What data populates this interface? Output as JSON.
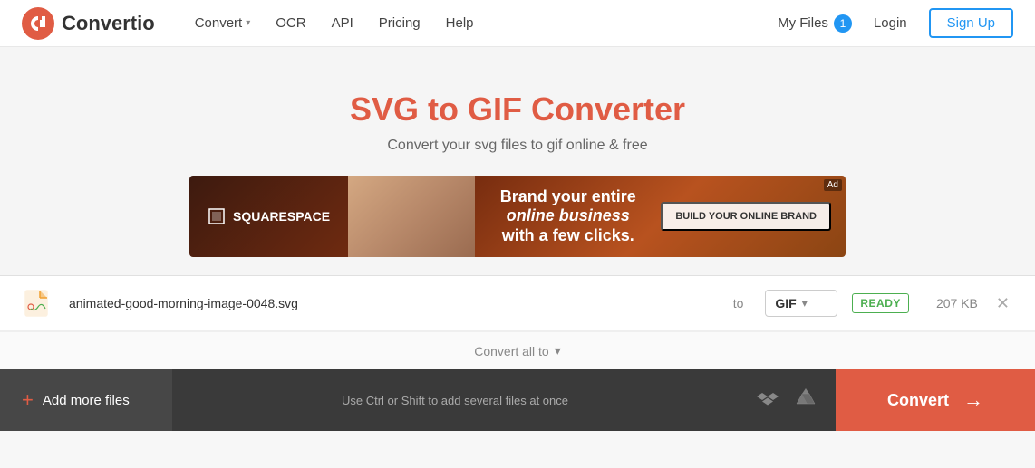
{
  "header": {
    "logo_text": "Convertio",
    "nav": [
      {
        "label": "Convert",
        "has_dropdown": true
      },
      {
        "label": "OCR",
        "has_dropdown": false
      },
      {
        "label": "API",
        "has_dropdown": false
      },
      {
        "label": "Pricing",
        "has_dropdown": false
      },
      {
        "label": "Help",
        "has_dropdown": false
      }
    ],
    "my_files_label": "My Files",
    "my_files_count": "1",
    "login_label": "Login",
    "signup_label": "Sign Up"
  },
  "hero": {
    "title": "SVG to GIF Converter",
    "subtitle": "Convert your svg files to gif online & free"
  },
  "ad": {
    "brand": "SQUARESPACE",
    "headline_line1": "Brand your entire",
    "headline_line2": "online business",
    "headline_line3": "with a few clicks.",
    "cta": "BUILD YOUR ONLINE BRAND",
    "badge": "Ad"
  },
  "file_row": {
    "filename": "animated-good-morning-image-0048.svg",
    "to_label": "to",
    "format": "GIF",
    "status": "READY",
    "size": "207 KB"
  },
  "convert_all": {
    "label": "Convert all to"
  },
  "bottom_bar": {
    "add_files_label": "Add more files",
    "drop_hint": "Use Ctrl or Shift to add several files at once",
    "convert_label": "Convert"
  }
}
